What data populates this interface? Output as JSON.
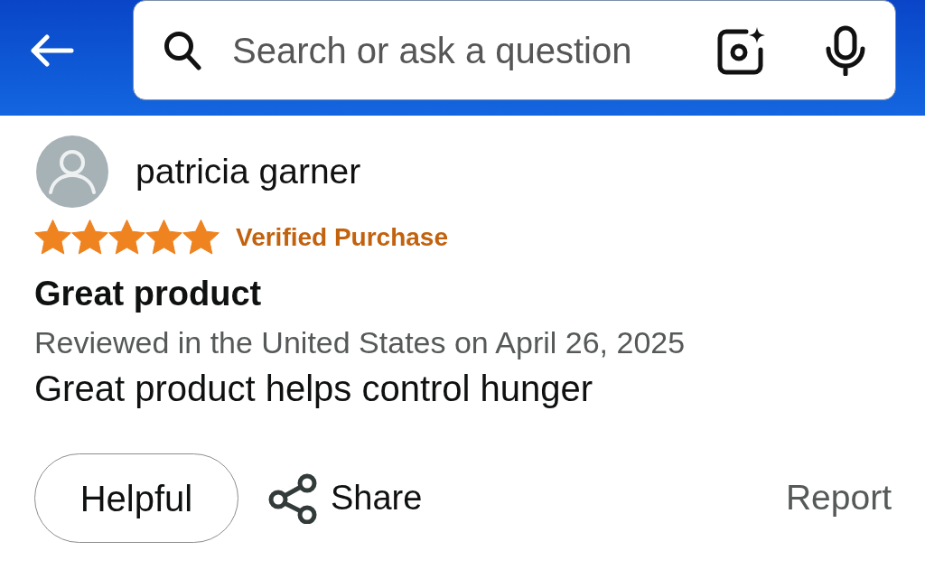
{
  "header": {
    "search": {
      "placeholder": "Search or ask a question"
    }
  },
  "review": {
    "reviewer": "patricia garner",
    "stars": 5,
    "badge": "Verified Purchase",
    "title": "Great product",
    "meta": "Reviewed in the United States on April 26, 2025",
    "body": "Great product helps control hunger"
  },
  "actions": [
    {
      "kind": "pill",
      "label": "Helpful"
    },
    {
      "kind": "share",
      "label": "Share"
    },
    {
      "kind": "link",
      "label": "Report"
    }
  ]
}
